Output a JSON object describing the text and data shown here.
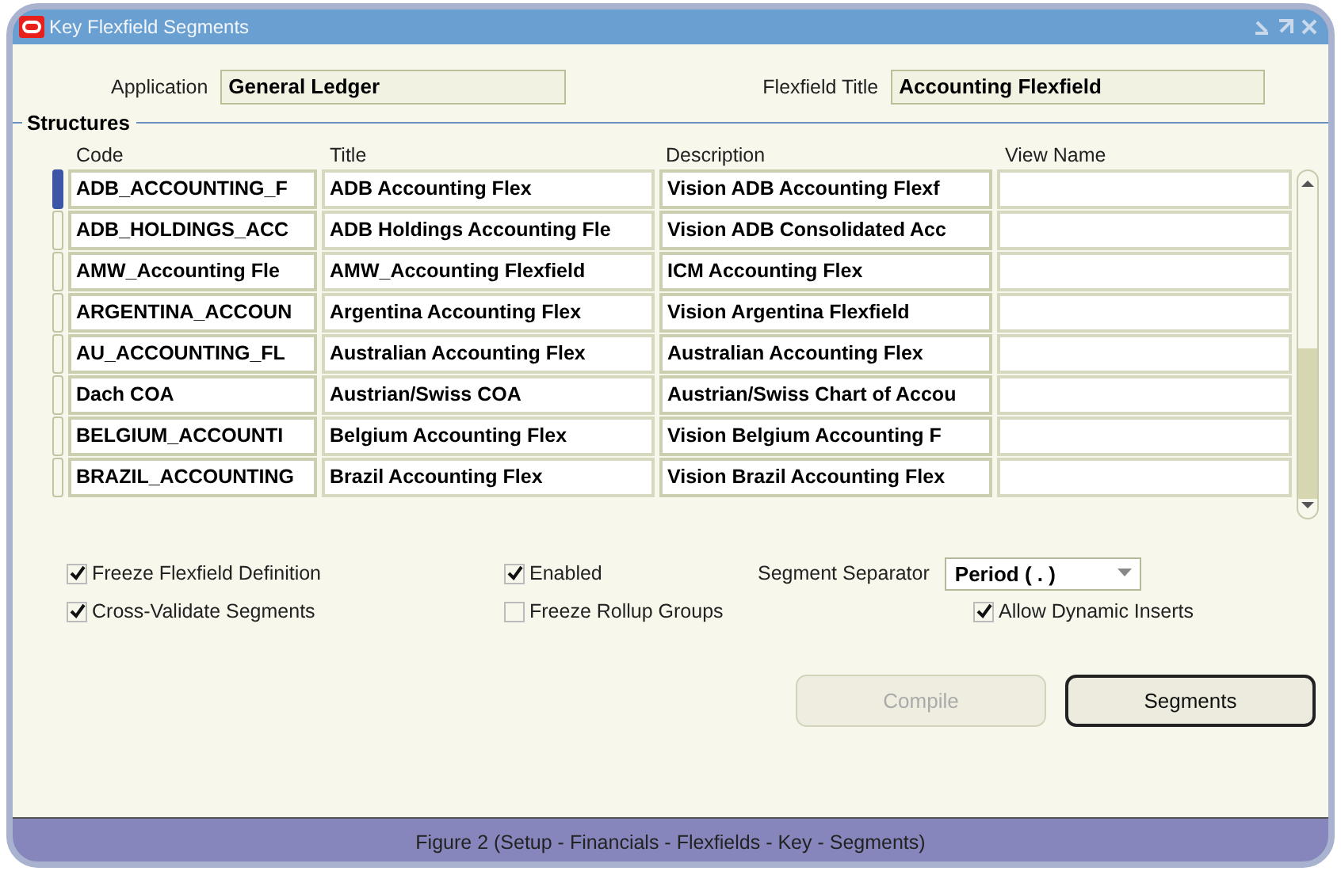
{
  "window": {
    "title": "Key Flexfield Segments"
  },
  "header": {
    "application_label": "Application",
    "application": "General Ledger",
    "flexfield_title_label": "Flexfield Title",
    "flexfield_title": "Accounting Flexfield"
  },
  "structures": {
    "title": "Structures",
    "columns": [
      "Code",
      "Title",
      "Description",
      "View Name"
    ],
    "rows": [
      {
        "selected": true,
        "code": "ADB_ACCOUNTING_F",
        "title": "ADB Accounting Flex",
        "description": "Vision ADB Accounting Flexf"
      },
      {
        "selected": false,
        "code": "ADB_HOLDINGS_ACC",
        "title": "ADB Holdings Accounting Fle",
        "description": "Vision ADB Consolidated Acc"
      },
      {
        "selected": false,
        "code": "AMW_Accounting Fle",
        "title": "AMW_Accounting Flexfield",
        "description": "ICM Accounting Flex"
      },
      {
        "selected": false,
        "code": "ARGENTINA_ACCOUN",
        "title": "Argentina Accounting Flex",
        "description": "Vision Argentina Flexfield"
      },
      {
        "selected": false,
        "code": "AU_ACCOUNTING_FL",
        "title": "Australian Accounting Flex",
        "description": "Australian Accounting Flex"
      },
      {
        "selected": false,
        "code": "Dach COA",
        "title": "Austrian/Swiss COA",
        "description": "Austrian/Swiss Chart of Accou"
      },
      {
        "selected": false,
        "code": "BELGIUM_ACCOUNTI",
        "title": "Belgium Accounting Flex",
        "description": "Vision Belgium Accounting F"
      },
      {
        "selected": false,
        "code": "BRAZIL_ACCOUNTING",
        "title": "Brazil Accounting Flex",
        "description": "Vision Brazil Accounting Flex"
      }
    ]
  },
  "options": [
    {
      "label": "Freeze Flexfield Definition",
      "checked": true
    },
    {
      "label": "Enabled",
      "checked": true
    },
    {
      "label": "Cross-Validate Segments",
      "checked": true
    },
    {
      "label": "Freeze Rollup Groups",
      "checked": false
    },
    {
      "label": "Allow Dynamic Inserts",
      "checked": true
    }
  ],
  "separator": {
    "label": "Segment Separator",
    "value": "Period ( . )"
  },
  "buttons": [
    {
      "label": "Compile",
      "disabled": true
    },
    {
      "label": "Segments",
      "disabled": false
    }
  ],
  "caption": "Figure 2 (Setup - Financials - Flexfields - Key - Segments)"
}
